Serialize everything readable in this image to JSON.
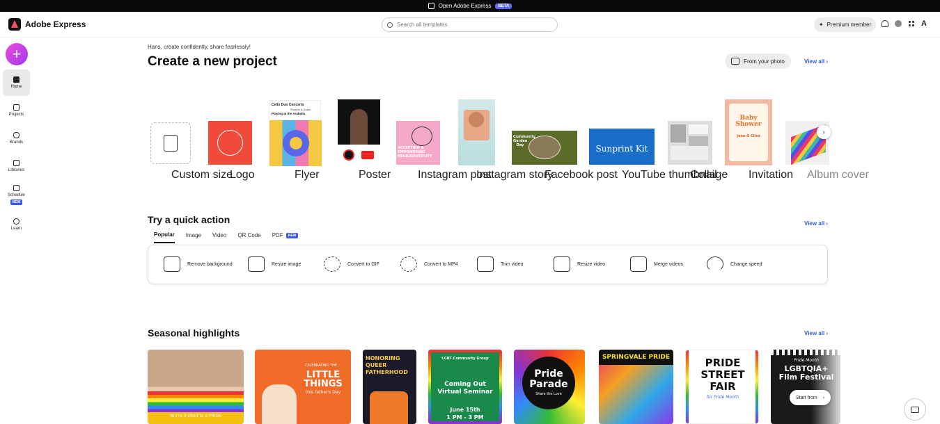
{
  "topbar": {
    "open_label": "Open Adobe Express",
    "beta": "BETA"
  },
  "header": {
    "app_name": "Adobe Express",
    "search_placeholder": "Search all templates",
    "premium_label": "Premium member"
  },
  "sidebar": {
    "items": [
      {
        "label": "Home"
      },
      {
        "label": "Projects"
      },
      {
        "label": "Brands"
      },
      {
        "label": "Libraries"
      },
      {
        "label": "Schedule",
        "badge": "NEW"
      },
      {
        "label": "Learn"
      }
    ]
  },
  "main": {
    "greeting": "Hans, create confidently, share fearlessly!",
    "title": "Create a new project",
    "from_photo": "From your photo",
    "view_all": "View all",
    "templates": [
      {
        "label": "Custom size"
      },
      {
        "label": "Logo"
      },
      {
        "label": "Flyer"
      },
      {
        "label": "Poster"
      },
      {
        "label": "Instagram post"
      },
      {
        "label": "Instagram story"
      },
      {
        "label": "Facebook post"
      },
      {
        "label": "YouTube thumbnail"
      },
      {
        "label": "Collage"
      },
      {
        "label": "Invitation"
      },
      {
        "label": "Album cover"
      }
    ],
    "flyer_text": {
      "title": "Cello Duo Concerto",
      "names": "Phoebe & Duran",
      "venue": "Playing at the Arabella"
    },
    "insta_text": "ACCEPTING & EMPOWERING NEURODIVERSITY",
    "fb_text": "Community Garden Day",
    "yt_text": "Sunprint Kit",
    "invite_text": {
      "line1": "Baby",
      "line2": "Shower",
      "names": "Jane & Clive"
    }
  },
  "quick": {
    "title": "Try a quick action",
    "view_all": "View all",
    "tabs": [
      {
        "label": "Popular"
      },
      {
        "label": "Image"
      },
      {
        "label": "Video"
      },
      {
        "label": "QR Code"
      },
      {
        "label": "PDF",
        "badge": "NEW"
      }
    ],
    "actions": [
      {
        "label": "Remove background"
      },
      {
        "label": "Resize image"
      },
      {
        "label": "Convert to GIF"
      },
      {
        "label": "Convert to MP4"
      },
      {
        "label": "Trim video"
      },
      {
        "label": "Resize video"
      },
      {
        "label": "Merge videos"
      },
      {
        "label": "Change speed"
      }
    ]
  },
  "seasonal": {
    "title": "Seasonal highlights",
    "view_all": "View all",
    "start_label": "Start from",
    "cards": [
      {
        "text": "You're invited to a PRIDE"
      },
      {
        "text": "LITTLE THINGS",
        "sub": "this Father's Day",
        "top": "CELEBRATING THE"
      },
      {
        "text": "HONORING QUEER FATHERHOOD"
      },
      {
        "text": "Coming Out Virtual Seminar",
        "top": "LGBT Community Group",
        "date": "June 15th",
        "time": "1 PM - 3 PM"
      },
      {
        "text": "Pride Parade",
        "sub": "Share the Love"
      },
      {
        "text": "SPRINGVALE PRIDE"
      },
      {
        "text": "PRIDE STREET FAIR",
        "sub": "for Pride Month"
      },
      {
        "text": "LGBTQIA+ Film Festival",
        "top": "Pride Month"
      }
    ]
  }
}
